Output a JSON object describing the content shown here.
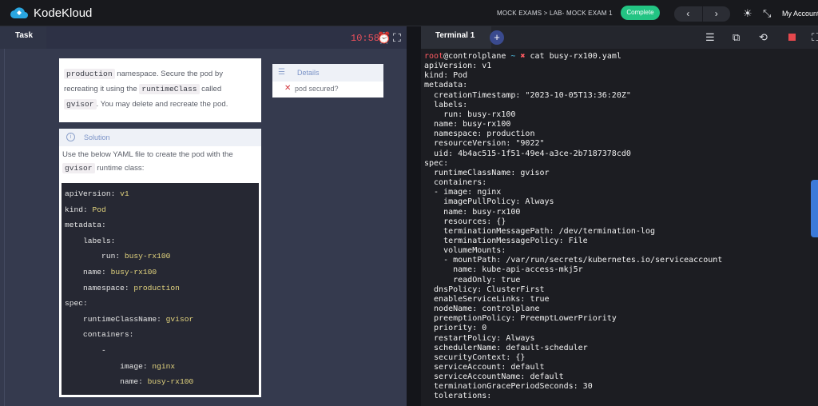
{
  "topbar": {
    "brand": "KodeKloud",
    "breadcrumb": "MOCK EXAMS > LAB- MOCK EXAM 1",
    "complete_label": "Complete",
    "prev_label": "‹",
    "next_label": "›",
    "account_label": "My Account"
  },
  "task": {
    "tab_label": "Task",
    "timer": "10:58",
    "question_parts": {
      "ns": "production",
      "t1": " namespace. Secure the pod by recreating it using the ",
      "rc": "runtimeClass",
      "t2": " called ",
      "name": "gvisor",
      "t3": ". You may delete and recreate the pod."
    },
    "details": {
      "header": "Details",
      "check_label": "pod secured?"
    },
    "solution": {
      "header": "Solution",
      "text1": "Use the below YAML file to create the pod with the ",
      "code": "gvisor",
      "text2": " runtime class:",
      "yaml": [
        {
          "k": "apiVersion: ",
          "v": "v1"
        },
        {
          "k": "kind: ",
          "v": "Pod"
        },
        {
          "k": "metadata:",
          "v": ""
        },
        {
          "k": "    labels:",
          "v": ""
        },
        {
          "k": "        run: ",
          "v": "busy-rx100"
        },
        {
          "k": "    name: ",
          "v": "busy-rx100"
        },
        {
          "k": "    namespace: ",
          "v": "production"
        },
        {
          "k": "spec:",
          "v": ""
        },
        {
          "k": "    runtimeClassName: ",
          "v": "gvisor"
        },
        {
          "k": "    containers:",
          "v": ""
        },
        {
          "k": "        -",
          "v": ""
        },
        {
          "k": "            image: ",
          "v": "nginx"
        },
        {
          "k": "            name: ",
          "v": "busy-rx100"
        }
      ]
    }
  },
  "terminal": {
    "tab_label": "Terminal 1",
    "plus_label": "+",
    "prompt_user": "root",
    "prompt_host": "@controlplane",
    "prompt_tilde": " ~ ",
    "prompt_x": "✖",
    "command": " cat busy-rx100.yaml",
    "lines": [
      "apiVersion: v1",
      "kind: Pod",
      "metadata:",
      "  creationTimestamp: \"2023-10-05T13:36:20Z\"",
      "  labels:",
      "    run: busy-rx100",
      "  name: busy-rx100",
      "  namespace: production",
      "  resourceVersion: \"9022\"",
      "  uid: 4b4ac515-1f51-49e4-a3ce-2b7187378cd0",
      "spec:",
      "  runtimeClassName: gvisor",
      "  containers:",
      "  - image: nginx",
      "    imagePullPolicy: Always",
      "    name: busy-rx100",
      "    resources: {}",
      "    terminationMessagePath: /dev/termination-log",
      "    terminationMessagePolicy: File",
      "    volumeMounts:",
      "    - mountPath: /var/run/secrets/kubernetes.io/serviceaccount",
      "      name: kube-api-access-mkj5r",
      "      readOnly: true",
      "  dnsPolicy: ClusterFirst",
      "  enableServiceLinks: true",
      "  nodeName: controlplane",
      "  preemptionPolicy: PreemptLowerPriority",
      "  priority: 0",
      "  restartPolicy: Always",
      "  schedulerName: default-scheduler",
      "  securityContext: {}",
      "  serviceAccount: default",
      "  serviceAccountName: default",
      "  terminationGracePeriodSeconds: 30",
      "  tolerations:"
    ]
  },
  "icons": {
    "brightness": "brightness-icon",
    "collapse": "collapse-icon",
    "alarm": "alarm-clock-icon",
    "fullscreen": "fullscreen-icon",
    "menu": "menu-icon",
    "open_external": "open-external-icon",
    "history": "history-icon",
    "stop": "stop-icon"
  },
  "colors": {
    "complete_green": "#23c483",
    "timer_red": "#e8505b",
    "prompt_red": "#ff5b62",
    "accent_blue": "#3c7ad9"
  }
}
